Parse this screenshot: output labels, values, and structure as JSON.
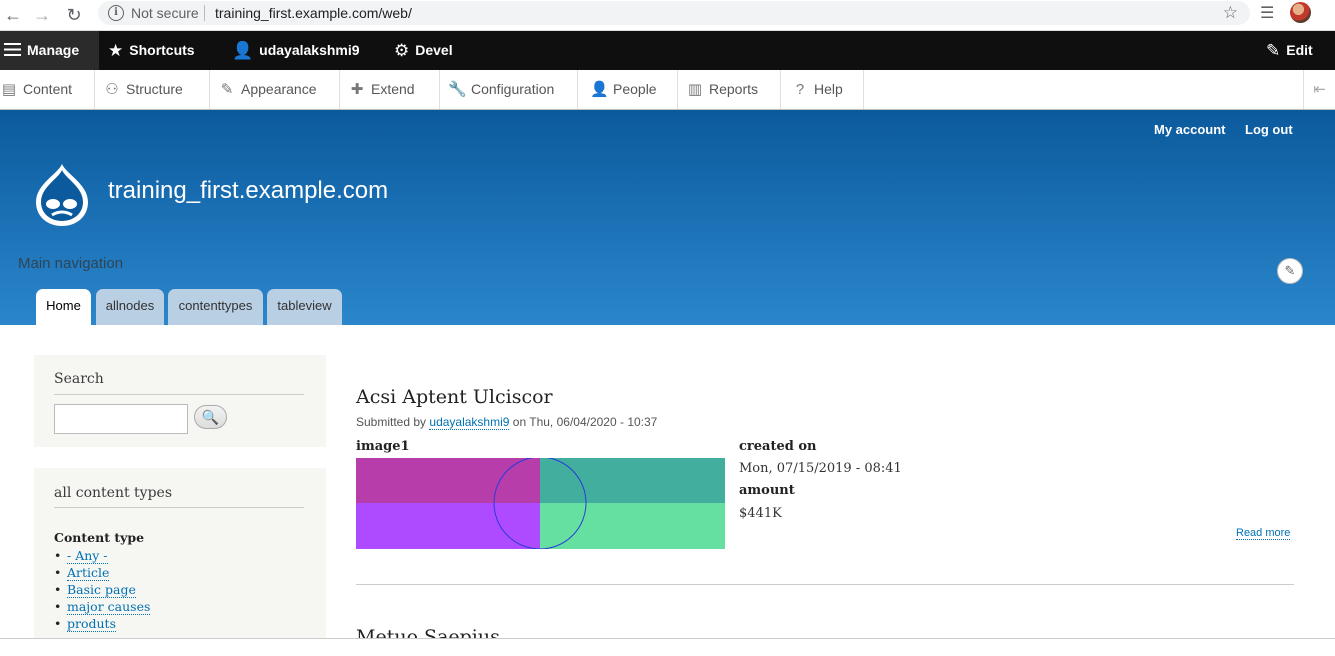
{
  "browser": {
    "back_icon": "←",
    "forward_icon": "→",
    "reload_icon": "↻",
    "security_text": "Not secure",
    "url": "training_first.example.com/web/",
    "bookmark_icon": "☆",
    "menu_icon": "☰"
  },
  "toolbar": {
    "manage_label": "Manage",
    "shortcuts_label": "Shortcuts",
    "user_label": "udayalakshmi9",
    "devel_label": "Devel",
    "edit_label": "Edit"
  },
  "tray": {
    "items": [
      {
        "label": "Content",
        "icon": "▤"
      },
      {
        "label": "Structure",
        "icon": "⚇"
      },
      {
        "label": "Appearance",
        "icon": "✎"
      },
      {
        "label": "Extend",
        "icon": "✚"
      },
      {
        "label": "Configuration",
        "icon": "🔧"
      },
      {
        "label": "People",
        "icon": "👤"
      },
      {
        "label": "Reports",
        "icon": "▥"
      },
      {
        "label": "Help",
        "icon": "?"
      }
    ],
    "collapse_icon": "⇤"
  },
  "header": {
    "my_account": "My account",
    "log_out": "Log out",
    "site_name": "training_first.example.com",
    "main_navigation_label": "Main navigation",
    "tabs": [
      "Home",
      "allnodes",
      "contenttypes",
      "tableview"
    ],
    "brand_color": "#0b5a9d"
  },
  "sidebar": {
    "search_title": "Search",
    "search_button_icon": "🔍",
    "content_types_title": "all content types",
    "content_type_label": "Content type",
    "content_types": [
      "- Any -",
      "Article",
      "Basic page",
      "major causes",
      "produts"
    ]
  },
  "article": {
    "title": "Acsi Aptent Ulciscor",
    "submitted_prefix": "Submitted by",
    "author": "udayalakshmi9",
    "submitted_suffix": "on Thu, 06/04/2020 - 10:37",
    "image_label": "image1",
    "created_label": "created on",
    "created_value": "Mon, 07/15/2019 - 08:41",
    "amount_label": "amount",
    "amount_value": "$441K",
    "read_more": "Read more",
    "image_colors": [
      "#b73daa",
      "#42ae9e",
      "#ae4aff",
      "#66e0a0"
    ]
  },
  "next_article": {
    "title": "Metuo Saepius"
  }
}
